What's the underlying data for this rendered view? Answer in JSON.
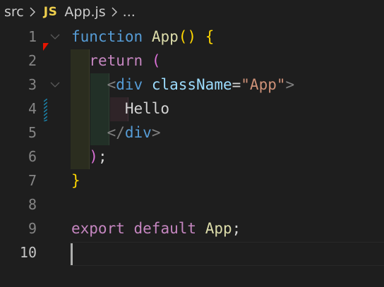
{
  "breadcrumb": {
    "folder": "src",
    "file_type_badge": "JS",
    "file": "App.js",
    "more": "..."
  },
  "editor": {
    "active_line": 10,
    "lines": [
      {
        "number": "1"
      },
      {
        "number": "2"
      },
      {
        "number": "3"
      },
      {
        "number": "4"
      },
      {
        "number": "5"
      },
      {
        "number": "6"
      },
      {
        "number": "7"
      },
      {
        "number": "8"
      },
      {
        "number": "9"
      },
      {
        "number": "10"
      }
    ],
    "tokens": {
      "l1_kw": "function",
      "l1_name": "App",
      "l1_parens": "()",
      "l1_brace": "{",
      "l2_kw": "return",
      "l2_paren": "(",
      "l3_open": "<",
      "l3_tag": "div",
      "l3_attr": "className",
      "l3_eq": "=",
      "l3_str": "\"App\"",
      "l3_close": ">",
      "l4_text": "Hello",
      "l5_open": "</",
      "l5_tag": "div",
      "l5_close": ">",
      "l6_paren": ")",
      "l6_semi": ";",
      "l7_brace": "}",
      "l9_kw1": "export",
      "l9_kw2": "default",
      "l9_name": "App",
      "l9_semi": ";"
    }
  },
  "colors": {
    "background": "#1e1e1e",
    "keyword_blue": "#569cd6",
    "keyword_purple": "#c586c0",
    "function_yellow": "#dcdcaa",
    "string_orange": "#ce9178",
    "attribute_lightblue": "#9cdcfe",
    "bracket_gold": "#ffd700",
    "bracket_pink": "#da70d6",
    "js_badge": "#f0d04d"
  },
  "icons": {
    "breadcrumb_separator": "chevron-right-icon",
    "fold": "chevron-down-icon",
    "breakpoint_hint": "red-triangle-marker",
    "modified": "dirty-diff-marker"
  }
}
